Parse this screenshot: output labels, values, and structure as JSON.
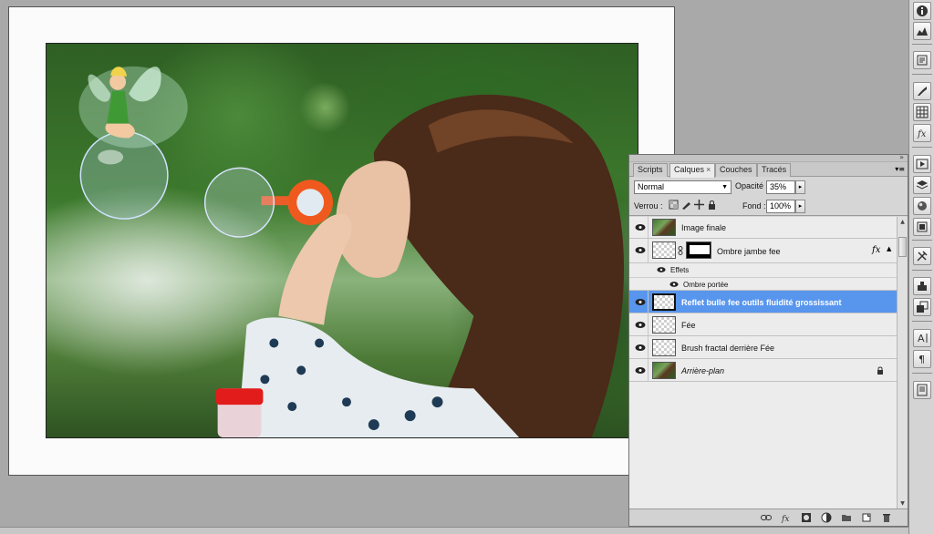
{
  "colors": {
    "selection": "#5896ee",
    "panel_bg": "#d6d6d6",
    "workspace": "#a9a9a9"
  },
  "panel": {
    "tabs": [
      {
        "label": "Scripts",
        "active": false
      },
      {
        "label": "Calques",
        "active": true,
        "close": "×"
      },
      {
        "label": "Couches",
        "active": false
      },
      {
        "label": "Tracés",
        "active": false
      }
    ],
    "blend_mode": "Normal",
    "opacity_label": "Opacité :",
    "opacity_value": "35%",
    "lock_label": "Verrou :",
    "fill_label": "Fond :",
    "fill_value": "100%",
    "layers": [
      {
        "name": "Image finale",
        "thumb": "photo",
        "selected": false
      },
      {
        "name": "Ombre jambe fee",
        "thumb": "checker",
        "mask": true,
        "fx": "fx",
        "selected": false
      },
      {
        "name": "Effets",
        "sub": true
      },
      {
        "name": "Ombre portée",
        "sub": true
      },
      {
        "name": "Reflet bulle fee outils fluidité grossissant",
        "thumb": "checker",
        "selected": true
      },
      {
        "name": "Fée",
        "thumb": "checker",
        "selected": false
      },
      {
        "name": "Brush fractal derrière Fée",
        "thumb": "checker",
        "selected": false
      },
      {
        "name": "Arrière-plan",
        "thumb": "photo",
        "locked": true,
        "italic": true,
        "selected": false
      }
    ]
  },
  "icons": {
    "toolbar": [
      "info-icon",
      "histogram-icon",
      "history-icon",
      "brush-presets-icon",
      "swatches-icon",
      "fx-icon",
      "actions-icon",
      "layers-icon",
      "3d-icon",
      "navigator-icon",
      "tools-icon",
      "clone-source-icon",
      "layer-comps-icon",
      "character-icon",
      "paragraph-icon",
      "notes-icon"
    ],
    "bottom_bar": [
      "link-icon",
      "fx-icon",
      "mask-icon",
      "adjustment-icon",
      "group-icon",
      "new-layer-icon",
      "trash-icon"
    ]
  }
}
